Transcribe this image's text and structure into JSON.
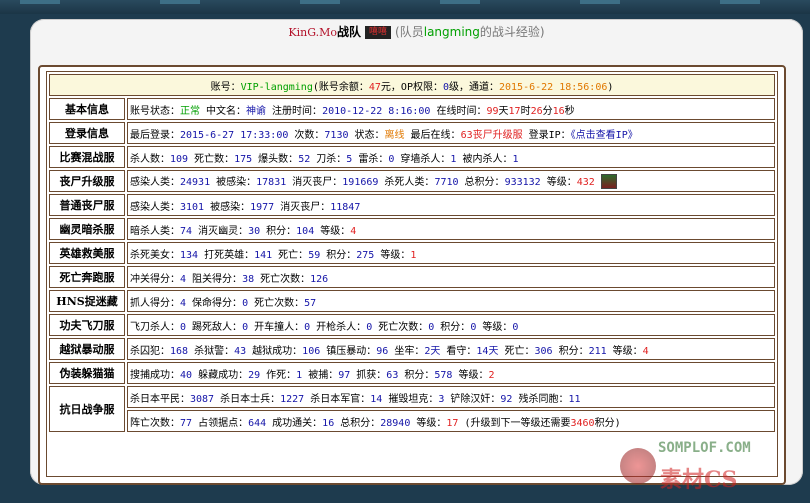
{
  "title": {
    "team": "KinG.Mo",
    "zhan": "战队",
    "badge": "嘻嘻",
    "member_prefix": "(队员",
    "member_name": "langming",
    "member_suffix": "的战斗经验)"
  },
  "account": {
    "label": "账号：",
    "vip": "VIP-langming",
    "balance_pre": "(账号余额：",
    "balance": "47",
    "balance_post": "元，OP权限：",
    "op": "0",
    "op_post": "级，通道：",
    "time": "2015-6-22 18:56:06",
    "end": ")"
  },
  "rows": {
    "basic": {
      "label": "基本信息",
      "status_l": "账号状态：",
      "status": "正常",
      "cn_l": " 中文名：",
      "cn": "神谕",
      "reg_l": " 注册时间：",
      "reg": "2010-12-22 8:16:00",
      "online_l": " 在线时间：",
      "d": "99",
      "d_u": "天",
      "h": "17",
      "h_u": "时",
      "m": "26",
      "m_u": "分",
      "s": "16",
      "s_u": "秒"
    },
    "login": {
      "label": "登录信息",
      "last_l": "最后登录：",
      "last": "2015-6-27 17:33:00",
      "cnt_l": " 次数：",
      "cnt": "7130",
      "st_l": " 状态：",
      "st": "离线",
      "ls_l": " 最后在线：",
      "ls": "63丧尸升级服",
      "ip_l": " 登录IP：",
      "ip": "《点击查看IP》"
    },
    "match": {
      "label": "比赛混战服",
      "k1_l": "杀人数：",
      "k1": "109",
      "k2_l": " 死亡数：",
      "k2": "175",
      "k3_l": " 爆头数：",
      "k3": "52",
      "k4_l": " 刀杀：",
      "k4": "5",
      "k5_l": " 雷杀：",
      "k5": "0",
      "k6_l": " 穿墙杀人：",
      "k6": "1",
      "k7_l": " 被内杀人：",
      "k7": "1"
    },
    "zombie": {
      "label": "丧尸升级服",
      "a_l": "感染人类：",
      "a": "24931",
      "b_l": " 被感染：",
      "b": "17831",
      "c_l": " 消灭丧尸：",
      "c": "191669",
      "d_l": " 杀死人类：",
      "d": "7710",
      "e_l": " 总积分：",
      "e": "933132",
      "f_l": " 等级：",
      "f": "432"
    },
    "normal": {
      "label": "普通丧尸服",
      "a_l": "感染人类：",
      "a": "3101",
      "b_l": " 被感染：",
      "b": "1977",
      "c_l": " 消灭丧尸：",
      "c": "11847"
    },
    "ghost": {
      "label": "幽灵暗杀服",
      "a_l": "暗杀人类：",
      "a": "74",
      "b_l": " 消灭幽灵：",
      "b": "30",
      "c_l": " 积分：",
      "c": "104",
      "d_l": " 等级：",
      "d": "4"
    },
    "hero": {
      "label": "英雄救美服",
      "a_l": "杀死美女：",
      "a": "134",
      "b_l": " 打死英雄：",
      "b": "141",
      "c_l": " 死亡：",
      "c": "59",
      "d_l": " 积分：",
      "d": "275",
      "e_l": " 等级：",
      "e": "1"
    },
    "run": {
      "label": "死亡奔跑服",
      "a_l": "冲关得分：",
      "a": "4",
      "b_l": " 阻关得分：",
      "b": "38",
      "c_l": " 死亡次数：",
      "c": "126"
    },
    "hns": {
      "label": "HNS捉迷藏",
      "a_l": "抓人得分：",
      "a": "4",
      "b_l": " 保命得分：",
      "b": "0",
      "c_l": " 死亡次数：",
      "c": "57"
    },
    "kungfu": {
      "label": "功夫飞刀服",
      "a_l": "飞刀杀人：",
      "a": "0",
      "b_l": " 踢死敌人：",
      "b": "0",
      "c_l": " 开车撞人：",
      "c": "0",
      "d_l": " 开枪杀人：",
      "d": "0",
      "e_l": " 死亡次数：",
      "e": "0",
      "f_l": " 积分：",
      "f": "0",
      "g_l": " 等级：",
      "g": "0"
    },
    "jail": {
      "label": "越狱暴动服",
      "a_l": "杀囚犯：",
      "a": "168",
      "b_l": " 杀狱警：",
      "b": "43",
      "c_l": " 越狱成功：",
      "c": "106",
      "d_l": " 镇压暴动：",
      "d": "96",
      "e_l": " 坐牢：",
      "e": "2",
      "e_u": "天",
      "f_l": " 看守：",
      "f": "14",
      "f_u": "天",
      "g_l": " 死亡：",
      "g": "306",
      "h_l": " 积分：",
      "h": "211",
      "i_l": " 等级：",
      "i": "4"
    },
    "disguise": {
      "label": "伪装躲猫猫",
      "a_l": "搜捕成功：",
      "a": "40",
      "b_l": " 躲藏成功：",
      "b": "29",
      "c_l": " 作死：",
      "c": "1",
      "d_l": " 被捕：",
      "d": "97",
      "e_l": " 抓获：",
      "e": "63",
      "f_l": " 积分：",
      "f": "578",
      "g_l": " 等级：",
      "g": "2"
    },
    "war": {
      "label": "抗日战争服",
      "a_l": "杀日本平民：",
      "a": "3087",
      "b_l": " 杀日本士兵：",
      "b": "1227",
      "c_l": " 杀日本军官：",
      "c": "14",
      "d_l": " 摧毁坦克：",
      "d": "3",
      "e_l": " 铲除汉奸：",
      "e": "92",
      "f_l": " 残杀同胞：",
      "f": "11",
      "g_l": "阵亡次数：",
      "g": "77",
      "h_l": " 占领据点：",
      "h": "644",
      "i_l": " 成功通关：",
      "i": "16",
      "j_l": " 总积分：",
      "j": "28940",
      "k_l": " 等级：",
      "k": "17",
      "l_l": " (升级到下一等级还需要",
      "l": "3460",
      "l_u": "积分)"
    }
  },
  "watermark": {
    "line1": "SOMPLOF.COM",
    "line2": "素材CS"
  },
  "colors": {
    "label": "#7a1a78",
    "blue": "#1414a8",
    "green": "#00a000",
    "red": "#e02020",
    "orange": "#e07800",
    "border": "#6b4a30"
  }
}
